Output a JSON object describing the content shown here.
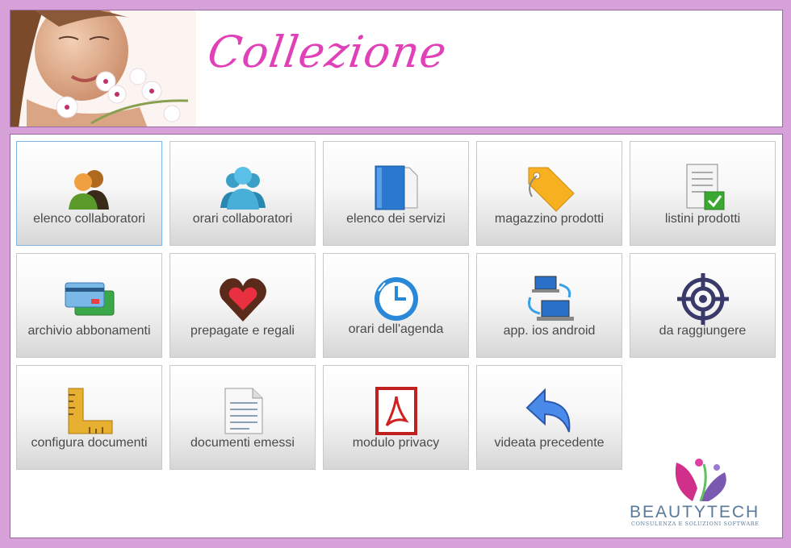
{
  "header": {
    "brand": "Collezione"
  },
  "menu": {
    "items": [
      {
        "label": "elenco collaboratori",
        "icon": "collaborators-icon"
      },
      {
        "label": "orari collaboratori",
        "icon": "staff-schedule-icon"
      },
      {
        "label": "elenco dei servizi",
        "icon": "services-folder-icon"
      },
      {
        "label": "magazzino prodotti",
        "icon": "price-tag-icon"
      },
      {
        "label": "listini prodotti",
        "icon": "price-list-check-icon"
      },
      {
        "label": "archivio abbonamenti",
        "icon": "credit-cards-icon"
      },
      {
        "label": "prepagate e regali",
        "icon": "chocolate-heart-icon"
      },
      {
        "label": "orari dell'agenda",
        "icon": "clock-icon"
      },
      {
        "label": "app. ios android",
        "icon": "network-computers-icon"
      },
      {
        "label": "da raggiungere",
        "icon": "target-icon"
      },
      {
        "label": "configura documenti",
        "icon": "ruler-icon"
      },
      {
        "label": "documenti emessi",
        "icon": "document-icon"
      },
      {
        "label": "modulo privacy",
        "icon": "pdf-icon"
      },
      {
        "label": "videata precedente",
        "icon": "back-arrow-icon"
      }
    ]
  },
  "footer": {
    "logo_name": "BEAUTYTECH",
    "logo_tagline": "CONSULENZA E SOLUZIONI SOFTWARE"
  },
  "colors": {
    "background": "#d6a0d8",
    "brand": "#e040b8",
    "selected_border": "#7fb3e6"
  }
}
